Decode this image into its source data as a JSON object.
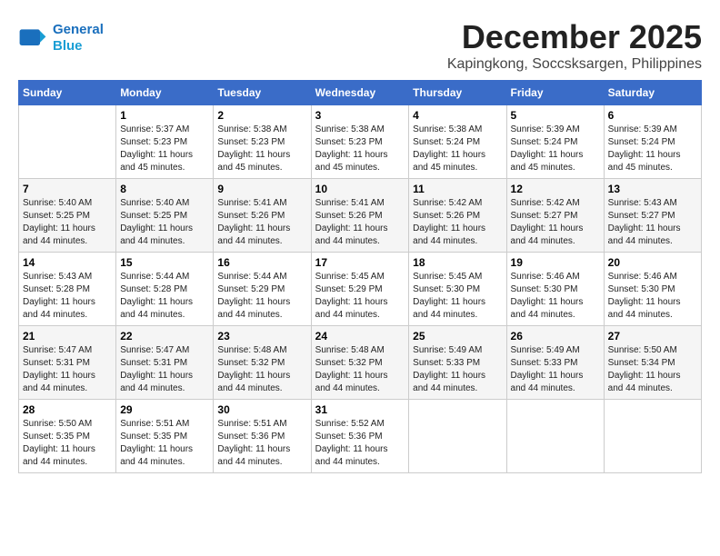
{
  "logo": {
    "line1": "General",
    "line2": "Blue"
  },
  "title": "December 2025",
  "subtitle": "Kapingkong, Soccsksargen, Philippines",
  "days_header": [
    "Sunday",
    "Monday",
    "Tuesday",
    "Wednesday",
    "Thursday",
    "Friday",
    "Saturday"
  ],
  "weeks": [
    [
      {
        "day": "",
        "info": ""
      },
      {
        "day": "1",
        "info": "Sunrise: 5:37 AM\nSunset: 5:23 PM\nDaylight: 11 hours\nand 45 minutes."
      },
      {
        "day": "2",
        "info": "Sunrise: 5:38 AM\nSunset: 5:23 PM\nDaylight: 11 hours\nand 45 minutes."
      },
      {
        "day": "3",
        "info": "Sunrise: 5:38 AM\nSunset: 5:23 PM\nDaylight: 11 hours\nand 45 minutes."
      },
      {
        "day": "4",
        "info": "Sunrise: 5:38 AM\nSunset: 5:24 PM\nDaylight: 11 hours\nand 45 minutes."
      },
      {
        "day": "5",
        "info": "Sunrise: 5:39 AM\nSunset: 5:24 PM\nDaylight: 11 hours\nand 45 minutes."
      },
      {
        "day": "6",
        "info": "Sunrise: 5:39 AM\nSunset: 5:24 PM\nDaylight: 11 hours\nand 45 minutes."
      }
    ],
    [
      {
        "day": "7",
        "info": "Sunrise: 5:40 AM\nSunset: 5:25 PM\nDaylight: 11 hours\nand 44 minutes."
      },
      {
        "day": "8",
        "info": "Sunrise: 5:40 AM\nSunset: 5:25 PM\nDaylight: 11 hours\nand 44 minutes."
      },
      {
        "day": "9",
        "info": "Sunrise: 5:41 AM\nSunset: 5:26 PM\nDaylight: 11 hours\nand 44 minutes."
      },
      {
        "day": "10",
        "info": "Sunrise: 5:41 AM\nSunset: 5:26 PM\nDaylight: 11 hours\nand 44 minutes."
      },
      {
        "day": "11",
        "info": "Sunrise: 5:42 AM\nSunset: 5:26 PM\nDaylight: 11 hours\nand 44 minutes."
      },
      {
        "day": "12",
        "info": "Sunrise: 5:42 AM\nSunset: 5:27 PM\nDaylight: 11 hours\nand 44 minutes."
      },
      {
        "day": "13",
        "info": "Sunrise: 5:43 AM\nSunset: 5:27 PM\nDaylight: 11 hours\nand 44 minutes."
      }
    ],
    [
      {
        "day": "14",
        "info": "Sunrise: 5:43 AM\nSunset: 5:28 PM\nDaylight: 11 hours\nand 44 minutes."
      },
      {
        "day": "15",
        "info": "Sunrise: 5:44 AM\nSunset: 5:28 PM\nDaylight: 11 hours\nand 44 minutes."
      },
      {
        "day": "16",
        "info": "Sunrise: 5:44 AM\nSunset: 5:29 PM\nDaylight: 11 hours\nand 44 minutes."
      },
      {
        "day": "17",
        "info": "Sunrise: 5:45 AM\nSunset: 5:29 PM\nDaylight: 11 hours\nand 44 minutes."
      },
      {
        "day": "18",
        "info": "Sunrise: 5:45 AM\nSunset: 5:30 PM\nDaylight: 11 hours\nand 44 minutes."
      },
      {
        "day": "19",
        "info": "Sunrise: 5:46 AM\nSunset: 5:30 PM\nDaylight: 11 hours\nand 44 minutes."
      },
      {
        "day": "20",
        "info": "Sunrise: 5:46 AM\nSunset: 5:30 PM\nDaylight: 11 hours\nand 44 minutes."
      }
    ],
    [
      {
        "day": "21",
        "info": "Sunrise: 5:47 AM\nSunset: 5:31 PM\nDaylight: 11 hours\nand 44 minutes."
      },
      {
        "day": "22",
        "info": "Sunrise: 5:47 AM\nSunset: 5:31 PM\nDaylight: 11 hours\nand 44 minutes."
      },
      {
        "day": "23",
        "info": "Sunrise: 5:48 AM\nSunset: 5:32 PM\nDaylight: 11 hours\nand 44 minutes."
      },
      {
        "day": "24",
        "info": "Sunrise: 5:48 AM\nSunset: 5:32 PM\nDaylight: 11 hours\nand 44 minutes."
      },
      {
        "day": "25",
        "info": "Sunrise: 5:49 AM\nSunset: 5:33 PM\nDaylight: 11 hours\nand 44 minutes."
      },
      {
        "day": "26",
        "info": "Sunrise: 5:49 AM\nSunset: 5:33 PM\nDaylight: 11 hours\nand 44 minutes."
      },
      {
        "day": "27",
        "info": "Sunrise: 5:50 AM\nSunset: 5:34 PM\nDaylight: 11 hours\nand 44 minutes."
      }
    ],
    [
      {
        "day": "28",
        "info": "Sunrise: 5:50 AM\nSunset: 5:35 PM\nDaylight: 11 hours\nand 44 minutes."
      },
      {
        "day": "29",
        "info": "Sunrise: 5:51 AM\nSunset: 5:35 PM\nDaylight: 11 hours\nand 44 minutes."
      },
      {
        "day": "30",
        "info": "Sunrise: 5:51 AM\nSunset: 5:36 PM\nDaylight: 11 hours\nand 44 minutes."
      },
      {
        "day": "31",
        "info": "Sunrise: 5:52 AM\nSunset: 5:36 PM\nDaylight: 11 hours\nand 44 minutes."
      },
      {
        "day": "",
        "info": ""
      },
      {
        "day": "",
        "info": ""
      },
      {
        "day": "",
        "info": ""
      }
    ]
  ]
}
